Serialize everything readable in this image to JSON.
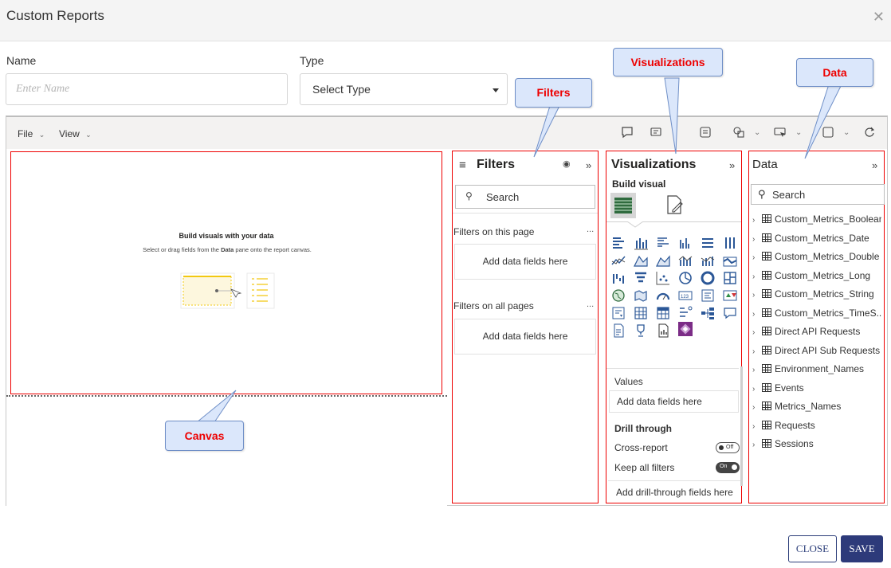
{
  "dialog": {
    "title": "Custom Reports"
  },
  "form": {
    "name_label": "Name",
    "name_placeholder": "Enter Name",
    "type_label": "Type",
    "type_value": "Select Type"
  },
  "toolbar": {
    "file": "File",
    "view": "View"
  },
  "canvas": {
    "title": "Build visuals with your data",
    "sub_prefix": "Select or drag fields from the ",
    "sub_bold": "Data",
    "sub_suffix": " pane onto the report canvas."
  },
  "filters": {
    "title": "Filters",
    "search_placeholder": "Search",
    "on_this_page": "Filters on this page",
    "on_all_pages": "Filters on all pages",
    "add_fields_1": "Add data fields here",
    "add_fields_2": "Add data fields here",
    "more": "..."
  },
  "visualizations": {
    "title": "Visualizations",
    "build_visual": "Build visual",
    "values_label": "Values",
    "values_add": "Add data fields here",
    "drill_through": "Drill through",
    "cross_report": "Cross-report",
    "cross_report_state": "Off",
    "keep_all_filters": "Keep all filters",
    "keep_all_filters_state": "On",
    "add_drill": "Add drill-through fields here"
  },
  "data": {
    "title": "Data",
    "search_placeholder": "Search",
    "tables": [
      "Custom_Metrics_Boolean",
      "Custom_Metrics_Date",
      "Custom_Metrics_Double",
      "Custom_Metrics_Long",
      "Custom_Metrics_String",
      "Custom_Metrics_TimeS...",
      "Direct API Requests",
      "Direct API Sub Requests",
      "Environment_Names",
      "Events",
      "Metrics_Names",
      "Requests",
      "Sessions"
    ]
  },
  "callouts": {
    "visualizations": "Visualizations",
    "filters": "Filters",
    "data": "Data",
    "canvas": "Canvas"
  },
  "buttons": {
    "close": "CLOSE",
    "save": "SAVE"
  },
  "colors": {
    "highlight_border": "#ee0000",
    "callout_bg": "#dbe7fb",
    "primary": "#2d3a7a",
    "viz_accent": "#f2c811"
  }
}
